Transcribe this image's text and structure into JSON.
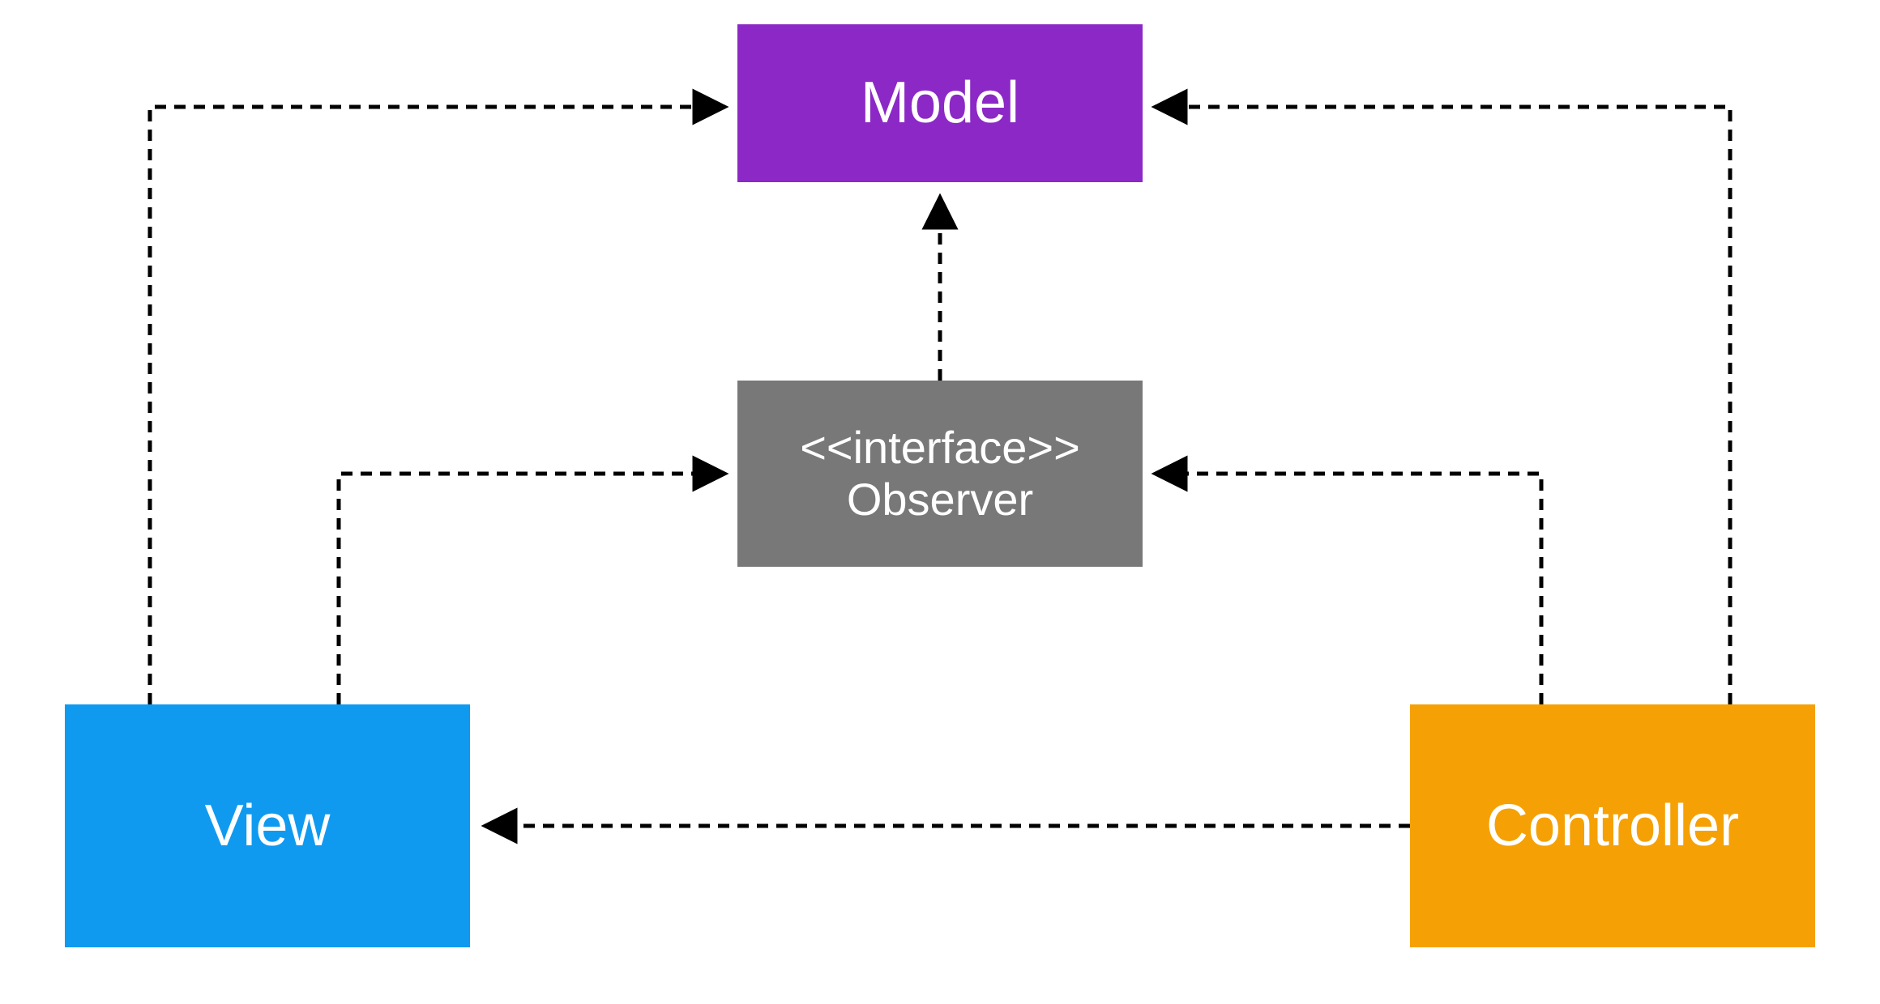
{
  "boxes": {
    "model": {
      "label": "Model",
      "fill": "#8C28C6"
    },
    "observer": {
      "stereo": "<<interface>>",
      "label": "Observer",
      "fill": "#787878"
    },
    "view": {
      "label": "View",
      "fill": "#0F9AF0"
    },
    "controller": {
      "label": "Controller",
      "fill": "#F5A105"
    }
  },
  "arrows": {
    "stroke": "#000000",
    "width": 5,
    "dash": "14 10"
  }
}
